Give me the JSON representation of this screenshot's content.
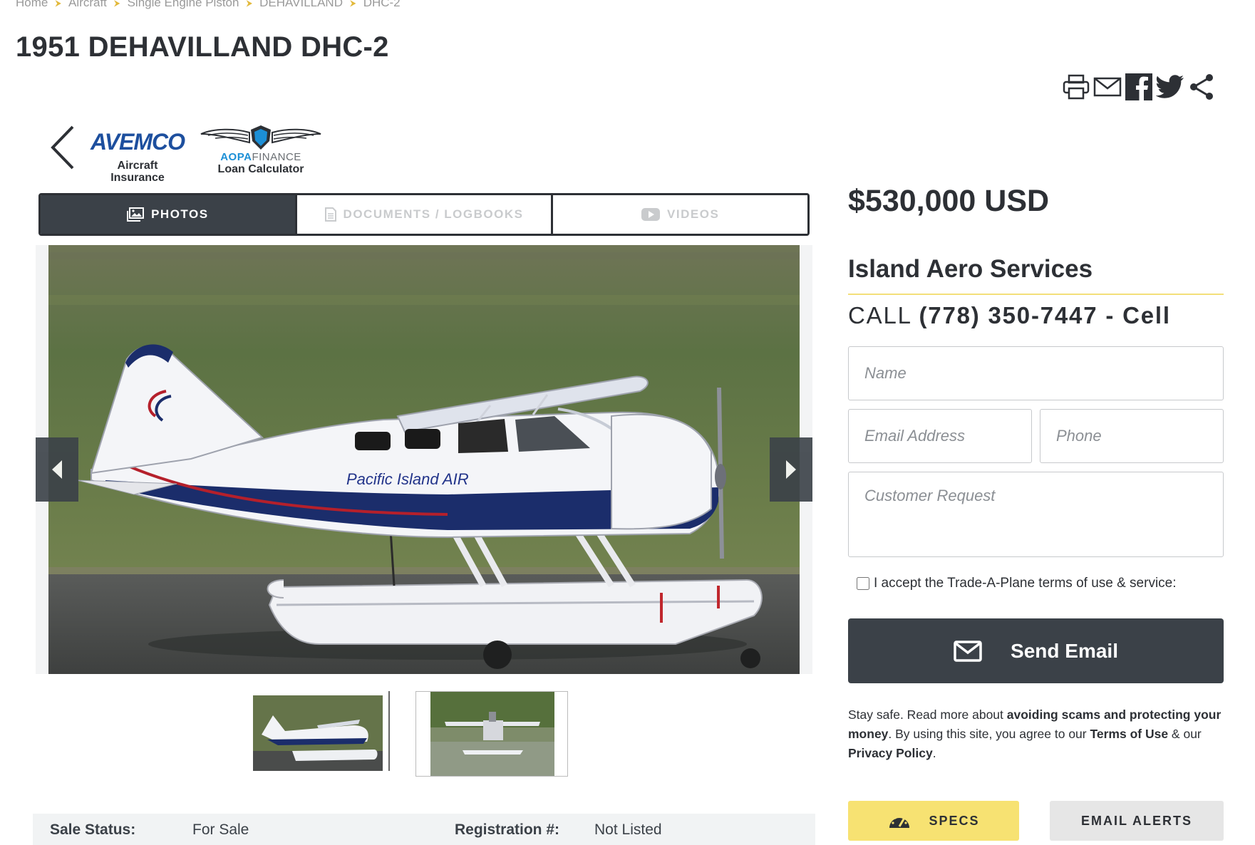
{
  "breadcrumb": [
    "Home",
    "Aircraft",
    "Single Engine Piston",
    "DEHAVILLAND",
    "DHC-2"
  ],
  "title": "1951 DEHAVILLAND DHC-2",
  "share_icons": [
    "print-icon",
    "email-icon",
    "facebook-icon",
    "twitter-icon",
    "share-icon"
  ],
  "partners": {
    "avemco": {
      "logo_text": "AVEMCO",
      "caption_line1": "Aircraft",
      "caption_line2": "Insurance"
    },
    "aopa": {
      "logo_aopa": "AOPA",
      "logo_finance": "FINANCE",
      "caption": "Loan Calculator"
    }
  },
  "media_tabs": [
    {
      "label": "PHOTOS",
      "icon": "photos-icon",
      "active": true
    },
    {
      "label": "DOCUMENTS / LOGBOOKS",
      "icon": "document-icon",
      "active": false
    },
    {
      "label": "VIDEOS",
      "icon": "video-icon",
      "active": false
    }
  ],
  "aircraft_livery": "Pacific Island AIR",
  "details": {
    "sale_status_label": "Sale Status:",
    "sale_status_value": "For Sale",
    "registration_label": "Registration #:",
    "registration_value": "Not Listed"
  },
  "price": "$530,000 USD",
  "dealer": {
    "name": "Island Aero Services",
    "call_label": "CALL",
    "phone": "(778) 350-7447 - Cell"
  },
  "form": {
    "name_placeholder": "Name",
    "email_placeholder": "Email Address",
    "phone_placeholder": "Phone",
    "request_placeholder": "Customer Request",
    "terms_label": "I accept the Trade-A-Plane terms of use & service:",
    "send_label": "Send Email"
  },
  "safety": {
    "lead": "Stay safe. Read more about ",
    "link_scams": "avoiding scams and protecting your money",
    "middle": ". By using this site, you agree to our ",
    "link_terms": "Terms of Use",
    "and": " & our ",
    "link_privacy": "Privacy Policy",
    "end": "."
  },
  "buttons": {
    "specs": "SPECS",
    "email_alerts": "EMAIL ALERTS"
  },
  "colors": {
    "dark": "#3b4148",
    "accent_yellow": "#f7e272",
    "aopa_blue": "#1c8fd6",
    "avemco_blue": "#1d4f9e"
  }
}
